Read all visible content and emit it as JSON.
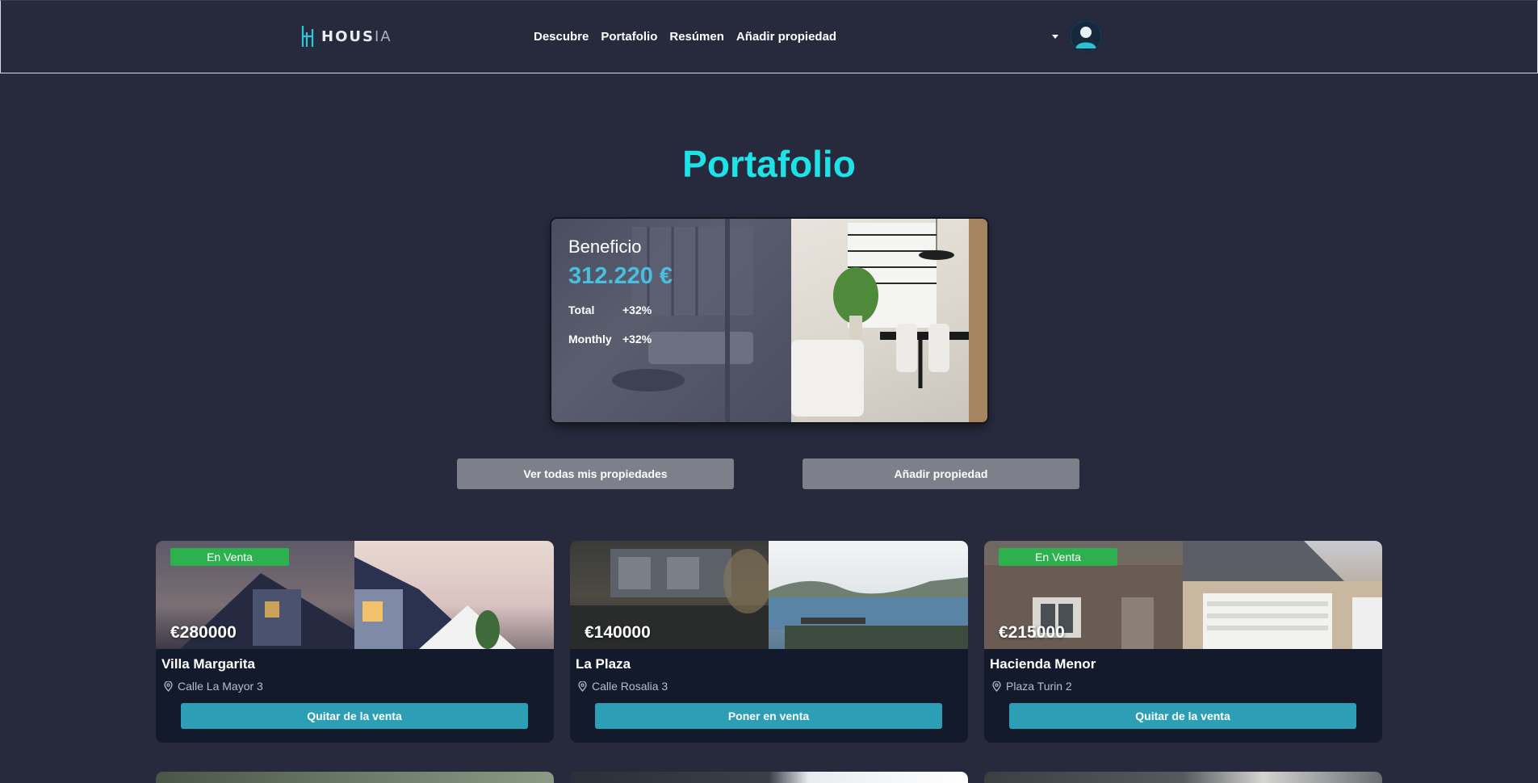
{
  "nav": {
    "logo_main": "HOUS",
    "logo_suffix": "IA",
    "links": [
      "Descubre",
      "Portafolio",
      "Resúmen",
      "Añadir propiedad"
    ],
    "user_icon": "user-avatar-icon"
  },
  "page": {
    "title": "Portafolio"
  },
  "stats": {
    "label": "Beneficio",
    "value": "312.220 €",
    "rows": [
      {
        "key": "Total",
        "value": "+32%"
      },
      {
        "key": "Monthly",
        "value": "+32%"
      }
    ]
  },
  "actions": {
    "view_all": "Ver todas mis propiedades",
    "add_property": "Añadir propiedad"
  },
  "properties": [
    {
      "badge": "En Venta",
      "price": "€280000",
      "name": "Villa Margarita",
      "address": "Calle La Mayor 3",
      "button": "Quitar de la venta"
    },
    {
      "badge": "",
      "price": "€140000",
      "name": "La Plaza",
      "address": "Calle Rosalia 3",
      "button": "Poner en venta"
    },
    {
      "badge": "En Venta",
      "price": "€215000",
      "name": "Hacienda Menor",
      "address": "Plaza Turin 2",
      "button": "Quitar de la venta"
    }
  ],
  "colors": {
    "background": "#272a3d",
    "accent_title": "#1de3e8",
    "stat_value": "#47bfe0",
    "badge_green": "#2db14f",
    "card_button": "#2c9fb7",
    "gray_button": "#7d7f8b"
  }
}
